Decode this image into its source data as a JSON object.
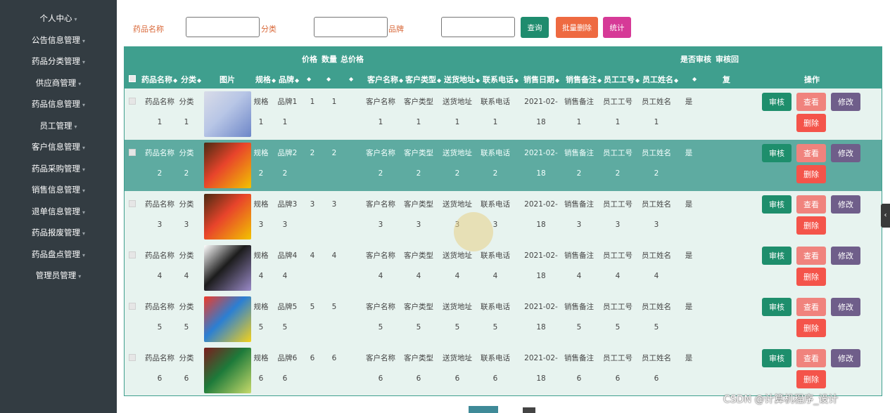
{
  "sidebar": {
    "items": [
      {
        "label": "个人中心"
      },
      {
        "label": "公告信息管理"
      },
      {
        "label": "药品分类管理"
      },
      {
        "label": "供应商管理"
      },
      {
        "label": "药品信息管理"
      },
      {
        "label": "员工管理"
      },
      {
        "label": "客户信息管理"
      },
      {
        "label": "药品采购管理"
      },
      {
        "label": "销售信息管理"
      },
      {
        "label": "退单信息管理"
      },
      {
        "label": "药品报废管理"
      },
      {
        "label": "药品盘点管理"
      },
      {
        "label": "管理员管理"
      }
    ]
  },
  "search": {
    "name_label": "药品名称",
    "category_label": "分类",
    "brand_label": "品牌",
    "query_button": "查询",
    "batch_delete_button": "批量删除",
    "stats_button": "统计"
  },
  "table": {
    "headers": {
      "name": "药品名称",
      "category": "分类",
      "image": "图片",
      "spec": "规格",
      "brand": "品牌",
      "price": "价格",
      "quantity": "数量",
      "total": "总价格",
      "customer_name": "客户名称",
      "customer_type": "客户类型",
      "address": "送货地址",
      "phone": "联系电话",
      "sale_date": "销售日期",
      "sale_note": "销售备注",
      "employee_no": "员工工号",
      "employee_name": "员工姓名",
      "audited": "是否审核",
      "audit_reply": "审核回",
      "audit_reply_2": "复",
      "actions": "操作"
    },
    "sort_glyph": "◆",
    "row_text": {
      "name": "药品名称",
      "category": "分类",
      "spec": "规格",
      "brand": "品牌",
      "customer_name": "客户名称",
      "customer_type": "客户类型",
      "address": "送货地址",
      "phone": "联系电话",
      "date_line1": "2021-02-",
      "date_line2": "18",
      "sale_note": "销售备注",
      "employee_no": "员工工号",
      "employee_name": "员工姓名",
      "audited": "是"
    },
    "rows": [
      {
        "n": "1"
      },
      {
        "n": "2"
      },
      {
        "n": "3"
      },
      {
        "n": "4"
      },
      {
        "n": "5"
      },
      {
        "n": "6"
      }
    ],
    "action_labels": {
      "audit": "审核",
      "view": "查看",
      "edit": "修改",
      "delete": "删除"
    }
  },
  "colors": {
    "header_bg": "#3f9f8e",
    "row_bg": "#e7f3ef",
    "selected_row_bg": "#5eaba1",
    "sidebar_bg": "#333c42"
  },
  "watermark": "CSDN @计算机程序_设计"
}
